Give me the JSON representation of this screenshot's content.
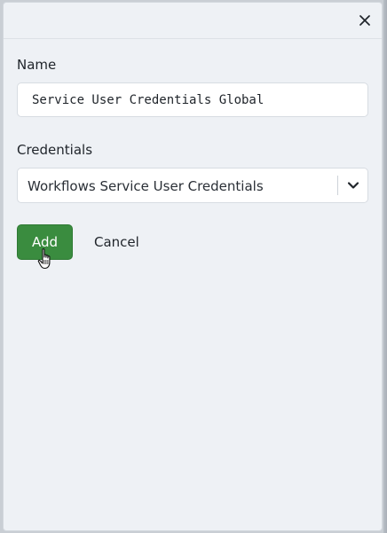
{
  "header": {
    "close_icon": "close-icon"
  },
  "form": {
    "name_label": "Name",
    "name_value": "Service User Credentials Global",
    "credentials_label": "Credentials",
    "credentials_selected": "Workflows Service User Credentials",
    "credentials_icon": "chevron-down-icon"
  },
  "actions": {
    "add_label": "Add",
    "cancel_label": "Cancel"
  },
  "cursor": {
    "icon": "hand-pointer-icon"
  },
  "colors": {
    "primary": "#3a8c3f",
    "panel_bg": "#eef1f5",
    "text": "#1f242a"
  }
}
